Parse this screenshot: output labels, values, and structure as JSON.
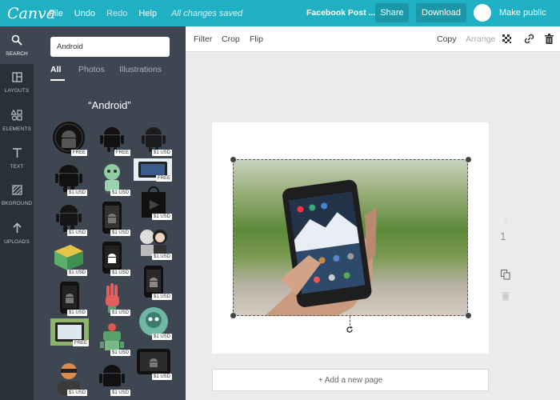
{
  "app": {
    "logo": "Canva",
    "menu": [
      "File",
      "Undo",
      "Redo",
      "Help"
    ],
    "saved_status": "All changes saved",
    "doc_title": "Facebook Post ...",
    "share_label": "Share",
    "download_label": "Download",
    "make_public_label": "Make public",
    "accent_color": "#1fb1c3"
  },
  "rail": [
    {
      "label": "SEARCH",
      "icon": "search-icon"
    },
    {
      "label": "LAYOUTS",
      "icon": "layouts-icon"
    },
    {
      "label": "ELEMENTS",
      "icon": "elements-icon"
    },
    {
      "label": "TEXT",
      "icon": "text-icon"
    },
    {
      "label": "BKGROUND",
      "icon": "background-icon"
    },
    {
      "label": "UPLOADS",
      "icon": "uploads-icon"
    }
  ],
  "search": {
    "value": "Android",
    "filters": [
      "All",
      "Photos",
      "Illustrations"
    ],
    "results_title": "“Android”",
    "results": [
      {
        "badge": "FREE",
        "icon": "android-round-badge-icon"
      },
      {
        "badge": "FREE",
        "icon": "android-robot-icon"
      },
      {
        "badge": "$1 USD",
        "icon": "android-robot-icon"
      },
      {
        "badge": "$1 USD",
        "icon": "android-robot-canva-icon"
      },
      {
        "badge": "$1 USD",
        "icon": "android-green-robot-icon"
      },
      {
        "badge": "FREE",
        "icon": "android-tablet-photo-icon"
      },
      {
        "badge": "$1 USD",
        "icon": "android-robot-icon"
      },
      {
        "badge": "$1 USD",
        "icon": "android-phone-icon"
      },
      {
        "badge": "$1 USD",
        "icon": "shopping-bag-play-icon"
      },
      {
        "badge": "$1 USD",
        "icon": "android-cube-icon"
      },
      {
        "badge": "$1 USD",
        "icon": "android-phone-icon"
      },
      {
        "badge": "$1 USD",
        "icon": "characters-icon"
      },
      {
        "badge": "$1 USD",
        "icon": "android-phone-icon"
      },
      {
        "badge": "$1 USD",
        "icon": "hand-icon"
      },
      {
        "badge": "$1 USD",
        "icon": "android-phone-icon"
      },
      {
        "badge": "FREE",
        "icon": "android-tablet-photo-icon"
      },
      {
        "badge": "$1 USD",
        "icon": "green-robot-icon"
      },
      {
        "badge": "$1 USD",
        "icon": "robot-head-icon"
      },
      {
        "badge": "$1 USD",
        "icon": "person-icon"
      },
      {
        "badge": "$1 USD",
        "icon": "android-robot-icon"
      },
      {
        "badge": "$1 USD",
        "icon": "android-tablet-icon"
      }
    ]
  },
  "toolbar": {
    "filter_label": "Filter",
    "crop_label": "Crop",
    "flip_label": "Flip",
    "copy_label": "Copy",
    "arrange_label": "Arrange"
  },
  "canvas": {
    "page_number": "1",
    "add_page_label": "+ Add a new page"
  }
}
